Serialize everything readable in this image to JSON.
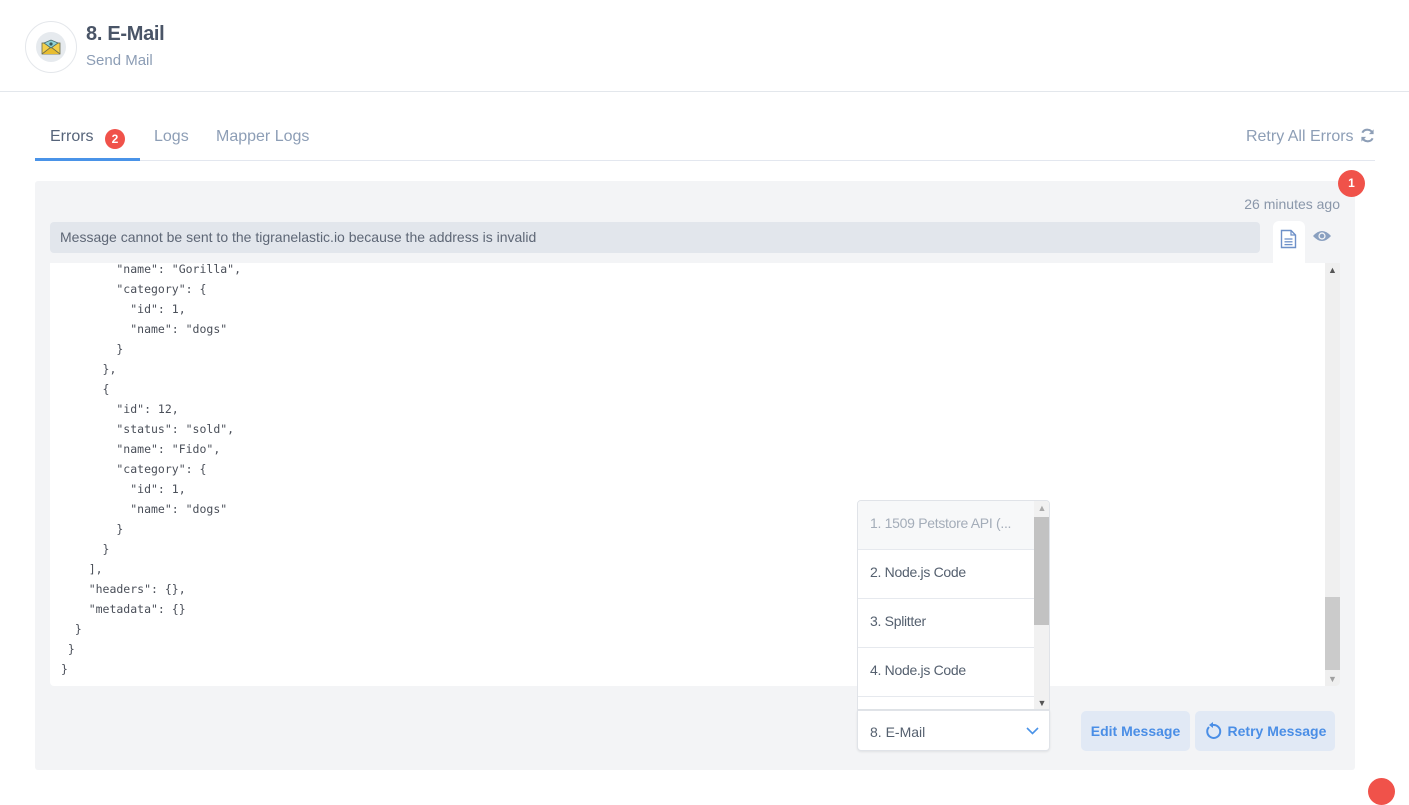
{
  "header": {
    "title": "8. E-Mail",
    "subtitle": "Send Mail",
    "icon": "envelope-icon"
  },
  "tabs": [
    {
      "label": "Errors",
      "badge": "2",
      "active": true
    },
    {
      "label": "Logs",
      "active": false
    },
    {
      "label": "Mapper Logs",
      "active": false
    }
  ],
  "retry_all": {
    "label": "Retry All Errors",
    "icon": "refresh-icon"
  },
  "error_card": {
    "count_badge": "1",
    "time": "26 minutes ago",
    "message": "Message cannot be sent to the tigranelastic.io because the address is invalid",
    "code_lines": [
      "        \"name\": \"Gorilla\",",
      "        \"category\": {",
      "          \"id\": 1,",
      "          \"name\": \"dogs\"",
      "        }",
      "      },",
      "      {",
      "        \"id\": 12,",
      "        \"status\": \"sold\",",
      "        \"name\": \"Fido\",",
      "        \"category\": {",
      "          \"id\": 1,",
      "          \"name\": \"dogs\"",
      "        }",
      "      }",
      "    ],",
      "    \"headers\": {},",
      "    \"metadata\": {}",
      "  }",
      " }",
      "}"
    ]
  },
  "step_dropdown": {
    "options": [
      {
        "label": "1. 1509 Petstore API (...",
        "disabled": true
      },
      {
        "label": "2. Node.js Code",
        "disabled": false
      },
      {
        "label": "3. Splitter",
        "disabled": false
      },
      {
        "label": "4. Node.js Code",
        "disabled": false
      }
    ],
    "selected": "8.  E-Mail"
  },
  "buttons": {
    "edit": "Edit Message",
    "retry": "Retry Message"
  },
  "colors": {
    "accent": "#4a93e8",
    "badge": "#f0524a",
    "button_bg": "#e1e9f5"
  }
}
